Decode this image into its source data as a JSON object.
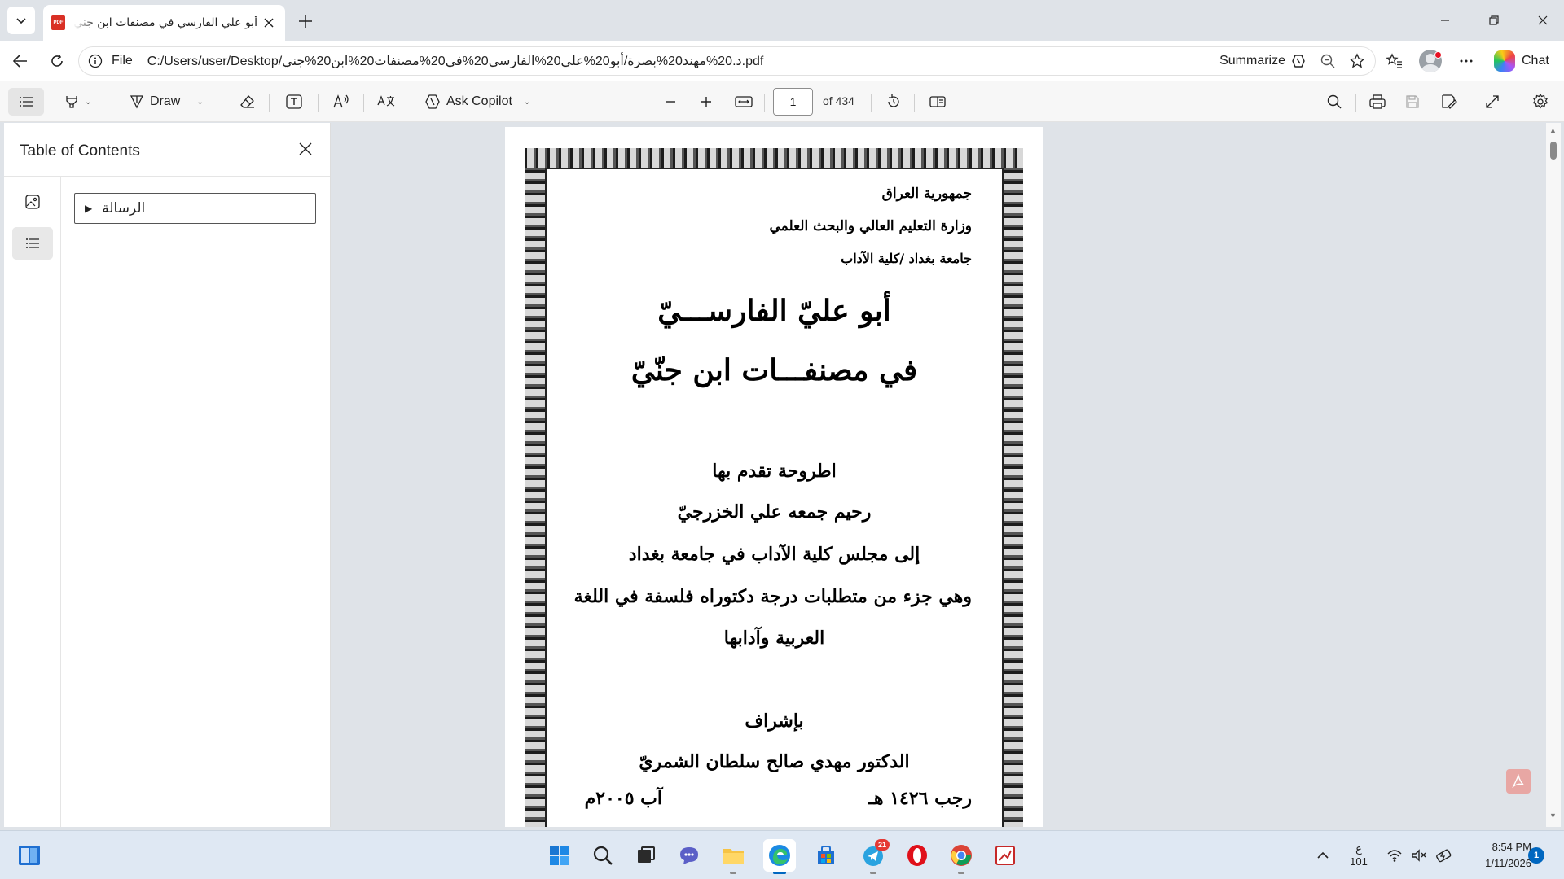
{
  "browser": {
    "tab": {
      "title": "أبو علي الفارسي في مصنفات ابن جني",
      "favicon_label": "PDF"
    },
    "address": {
      "scheme_label": "File",
      "url": "C:/Users/user/Desktop/د.20%مهند20%بصرة/أبو20%علي20%الفارسي20%في20%مصنفات20%ابن20%جني.pdf",
      "summarize_label": "Summarize"
    },
    "chat_label": "Chat"
  },
  "pdf_toolbar": {
    "draw_label": "Draw",
    "ask_copilot_label": "Ask Copilot",
    "current_page": "1",
    "page_count_label": "of 434"
  },
  "side_pane": {
    "title": "Table of Contents",
    "toc_items": [
      {
        "label": "الرسالة"
      }
    ]
  },
  "document": {
    "header_lines": [
      "جمهورية العراق",
      "وزارة التعليم العالي والبحث العلمي",
      "جامعة بغداد /كلية الآداب"
    ],
    "title_line1": "أبو عليّ الفارســـيّ",
    "title_line2": "في مصنفـــات ابن جنّيّ",
    "body_lines": [
      "اطروحة تقدم بها",
      "رحيم جمعه علي الخزرجيّ",
      "إلى مجلس كلية الآداب في جامعة بغداد",
      "وهي جزء من متطلبات درجة دكتوراه فلسفة في اللغة",
      "العربية وآدابها"
    ],
    "supervision_label": "بإشراف",
    "supervisor": "الدكتور مهدي صالح سلطان الشمريّ",
    "date_hijri": "رجب ١٤٢٦ هـ",
    "date_gregorian": "آب ٢٠٠٥م"
  },
  "taskbar": {
    "tray_lang_top": "ع",
    "tray_lang_bottom": "101",
    "time": "8:54 PM",
    "date": "1/11/2026",
    "notification_count": "1",
    "telegram_badge": "21"
  }
}
